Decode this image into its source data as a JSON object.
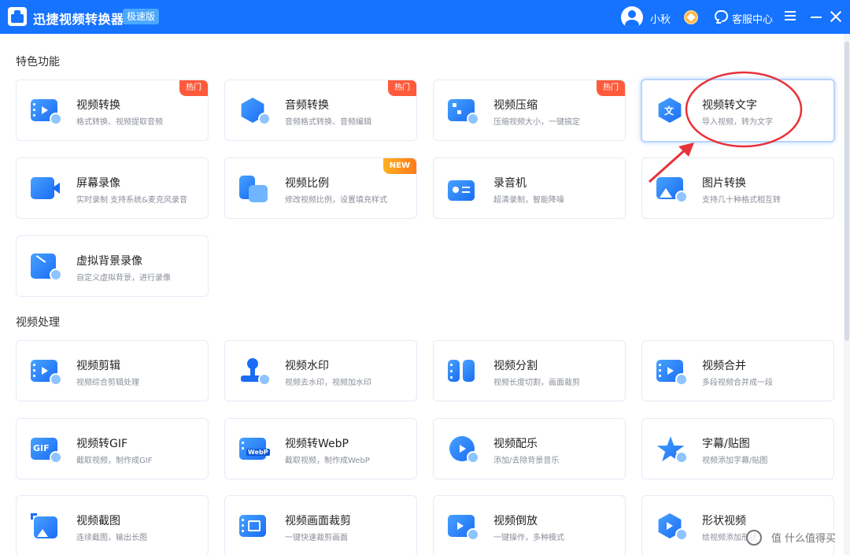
{
  "window": {
    "title": "迅捷视频转换器",
    "edition": "极速版",
    "username": "小秋",
    "service_label": "客服中心",
    "accent": "#1673ff"
  },
  "sections": [
    {
      "title": "特色功能",
      "cards": [
        {
          "title": "视频转换",
          "desc": "格式转换、视频提取音频",
          "badge": "热门",
          "icon": "video-convert-icon"
        },
        {
          "title": "音频转换",
          "desc": "音频格式转换、音频编辑",
          "badge": "热门",
          "icon": "audio-convert-icon"
        },
        {
          "title": "视频压缩",
          "desc": "压缩视频大小，一键搞定",
          "badge": "热门",
          "icon": "video-compress-icon"
        },
        {
          "title": "视频转文字",
          "desc": "导入视频，转为文字",
          "badge": "",
          "icon": "video-to-text-icon"
        },
        {
          "title": "屏幕录像",
          "desc": "实时录制 支持系统&麦克风录音",
          "badge": "",
          "icon": "screen-record-icon"
        },
        {
          "title": "视频比例",
          "desc": "修改视频比例，设置填充样式",
          "badge": "NEW",
          "icon": "video-ratio-icon"
        },
        {
          "title": "录音机",
          "desc": "超清录制，智能降噪",
          "badge": "",
          "icon": "recorder-icon"
        },
        {
          "title": "图片转换",
          "desc": "支持几十种格式相互转",
          "badge": "",
          "icon": "image-convert-icon"
        },
        {
          "title": "虚拟背景录像",
          "desc": "自定义虚拟背景，进行录像",
          "badge": "",
          "icon": "virtual-bg-icon"
        }
      ]
    },
    {
      "title": "视频处理",
      "cards": [
        {
          "title": "视频剪辑",
          "desc": "视频综合剪辑处理",
          "badge": "",
          "icon": "video-edit-icon"
        },
        {
          "title": "视频水印",
          "desc": "视频去水印，视频加水印",
          "badge": "",
          "icon": "video-watermark-icon"
        },
        {
          "title": "视频分割",
          "desc": "视频长度切割，画面裁剪",
          "badge": "",
          "icon": "video-split-icon"
        },
        {
          "title": "视频合并",
          "desc": "多段视频合并成一段",
          "badge": "",
          "icon": "video-merge-icon"
        },
        {
          "title": "视频转GIF",
          "desc": "截取视频，制作成GIF",
          "badge": "",
          "icon": "video-gif-icon"
        },
        {
          "title": "视频转WebP",
          "desc": "截取视频，制作成WebP",
          "badge": "",
          "icon": "video-webp-icon"
        },
        {
          "title": "视频配乐",
          "desc": "添加/去除背景音乐",
          "badge": "",
          "icon": "video-music-icon"
        },
        {
          "title": "字幕/贴图",
          "desc": "视频添加字幕/贴图",
          "badge": "",
          "icon": "subtitle-sticker-icon"
        },
        {
          "title": "视频截图",
          "desc": "连续截图，输出长图",
          "badge": "",
          "icon": "video-screenshot-icon"
        },
        {
          "title": "视频画面裁剪",
          "desc": "一键快速裁剪画面",
          "badge": "",
          "icon": "video-crop-icon"
        },
        {
          "title": "视频倒放",
          "desc": "一键操作，多种模式",
          "badge": "",
          "icon": "video-reverse-icon"
        },
        {
          "title": "形状视频",
          "desc": "给视频添加形状",
          "badge": "",
          "icon": "shape-video-icon"
        }
      ]
    }
  ],
  "icon_labels": {
    "gif": "GIF",
    "webp": "WebP",
    "text": "文"
  },
  "watermark": "值 什么值得买"
}
